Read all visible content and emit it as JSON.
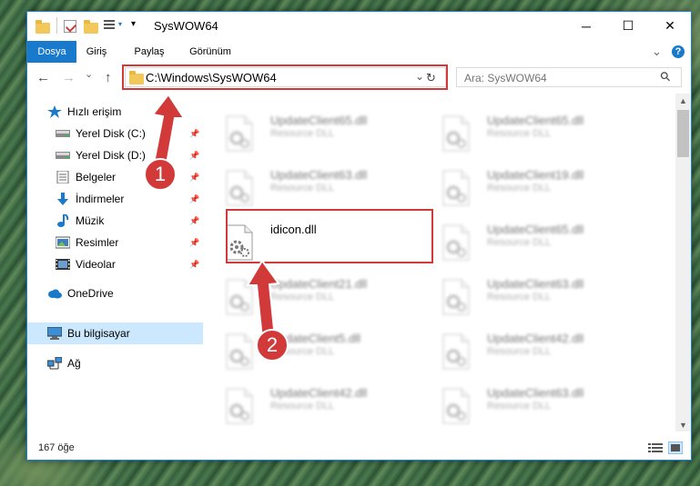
{
  "window": {
    "title": "SysWOW64",
    "minimize_glyph": "─",
    "maximize_glyph": "☐",
    "close_glyph": "✕"
  },
  "ribbon": {
    "tabs": [
      "Dosya",
      "Giriş",
      "Paylaş",
      "Görünüm"
    ],
    "active_tab": "Dosya",
    "expand_glyph": "⌄",
    "help_glyph": "?"
  },
  "navigation": {
    "back_glyph": "←",
    "forward_glyph": "→",
    "recent_glyph": "⌄",
    "up_glyph": "↑",
    "address": "C:\\Windows\\SysWOW64",
    "dropdown_glyph": "⌄",
    "refresh_glyph": "↻",
    "search_placeholder": "Ara: SysWOW64",
    "search_icon_glyph": "⚲"
  },
  "sidebar": {
    "quick_access": "Hızlı erişim",
    "items": [
      {
        "label": "Yerel Disk (C:)",
        "icon": "drive-icon"
      },
      {
        "label": "Yerel Disk (D:)",
        "icon": "drive-icon"
      },
      {
        "label": "Belgeler",
        "icon": "documents-icon"
      },
      {
        "label": "İndirmeler",
        "icon": "downloads-icon"
      },
      {
        "label": "Müzik",
        "icon": "music-icon"
      },
      {
        "label": "Resimler",
        "icon": "pictures-icon"
      },
      {
        "label": "Videolar",
        "icon": "videos-icon"
      }
    ],
    "pin_glyph": "📌",
    "onedrive": "OneDrive",
    "this_pc": "Bu bilgisayar",
    "network": "Ağ"
  },
  "files": {
    "left_column": [
      {
        "name": "UpdateClient65.dll",
        "type": "Resource DLL"
      },
      {
        "name": "UpdateClient63.dll",
        "type": "Resource DLL"
      },
      {
        "name": "idicon.dll",
        "type": ""
      },
      {
        "name": "UpdateClient21.dll",
        "type": "Resource DLL"
      },
      {
        "name": "UpdateClient5.dll",
        "type": "Resource DLL"
      },
      {
        "name": "UpdateClient42.dll",
        "type": "Resource DLL"
      }
    ],
    "right_column": [
      {
        "name": "UpdateClient65.dll",
        "type": "Resource DLL"
      },
      {
        "name": "UpdateClient19.dll",
        "type": "Resource DLL"
      },
      {
        "name": "UpdateClient65.dll",
        "type": "Resource DLL"
      },
      {
        "name": "UpdateClient63.dll",
        "type": "Resource DLL"
      },
      {
        "name": "UpdateClient42.dll",
        "type": "Resource DLL"
      },
      {
        "name": "UpdateClient63.dll",
        "type": "Resource DLL"
      }
    ]
  },
  "status": {
    "item_count": "167 öğe"
  },
  "annotations": {
    "step1": "1",
    "step2": "2",
    "color": "#d23a3a"
  },
  "colors": {
    "accent": "#1979ca",
    "selection": "#cce8ff"
  }
}
